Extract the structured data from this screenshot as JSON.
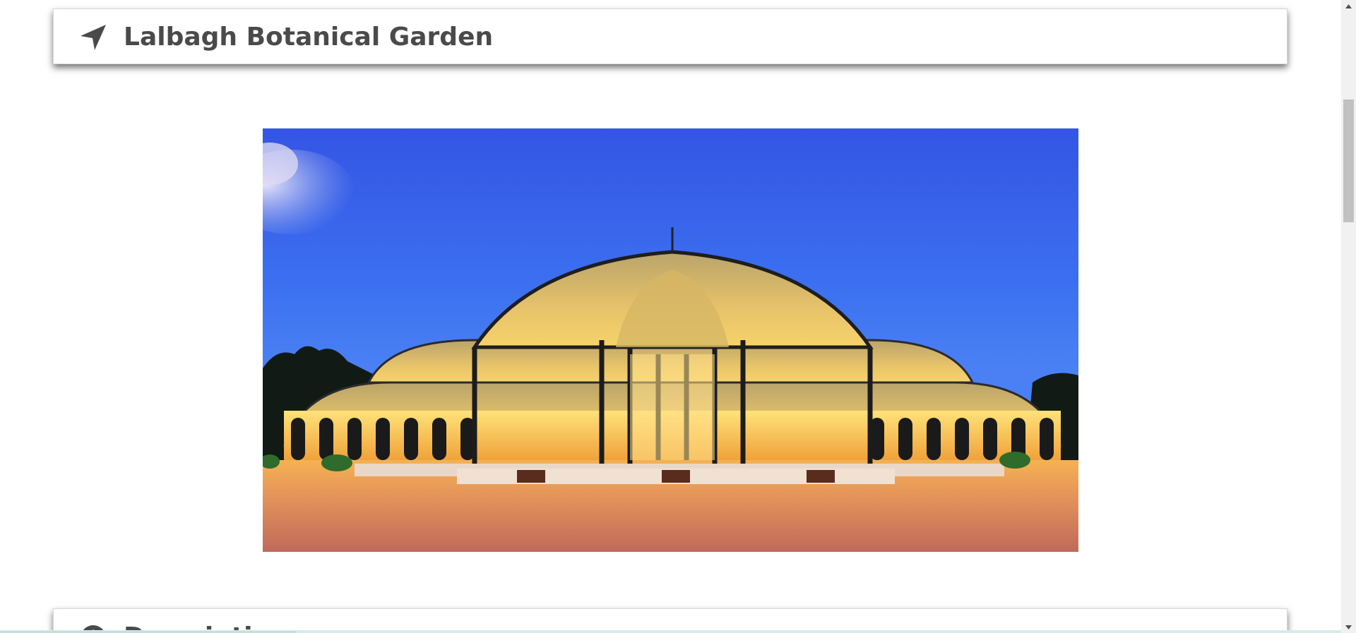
{
  "place": {
    "title": "Lalbagh Botanical Garden",
    "icon": "location-arrow-icon"
  },
  "photo": {
    "alt": "Lalbagh Glass House illuminated at dusk"
  },
  "description_section": {
    "title": "Description",
    "icon": "info-circle-icon"
  },
  "colors": {
    "title_text": "#4a4a4a",
    "sky_top": "#2f5ce6",
    "sky_bottom": "#3c7cf2",
    "lights": "#f7c445",
    "ground": "#d98a45"
  },
  "scrollbar": {
    "up_icon": "scroll-up-arrow-icon",
    "down_icon": "scroll-down-arrow-icon"
  }
}
